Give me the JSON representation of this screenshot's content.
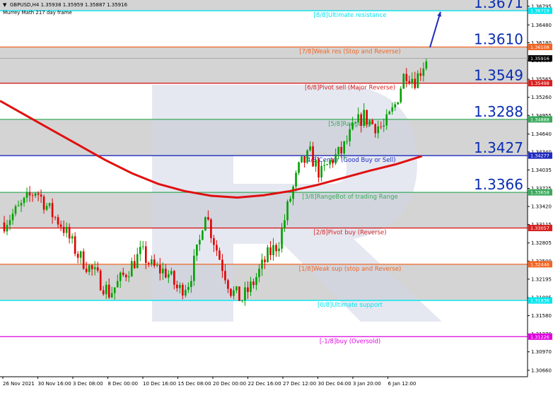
{
  "header": {
    "symbol_line": "GBPUSD,H4  1.35938 1.35959 1.35887 1.35916",
    "indicator_line": "Murrey Math 217 day frame"
  },
  "chart_data": {
    "type": "candlestick",
    "symbol": "GBPUSD",
    "timeframe": "H4",
    "ohlc": {
      "open": 1.35938,
      "high": 1.35959,
      "low": 1.35887,
      "close": 1.35916
    },
    "current_price": 1.35916,
    "ylim": [
      1.3055,
      1.369
    ],
    "x_ticks": [
      "26 Nov 2021",
      "30 Nov 16:00",
      "3 Dec 08:00",
      "8 Dec 00:00",
      "10 Dec 16:00",
      "15 Dec 08:00",
      "20 Dec 00:00",
      "22 Dec 16:00",
      "27 Dec 12:00",
      "30 Dec 04:00",
      "3 Jan 20:00",
      "6 Jan 12:00"
    ],
    "y_ticks": [
      "1.36795",
      "1.36480",
      "1.36180",
      "1.35880",
      "1.35565",
      "1.35260",
      "1.34955",
      "1.34640",
      "1.34340",
      "1.34035",
      "1.33725",
      "1.33420",
      "1.33115",
      "1.32805",
      "1.32500",
      "1.32195",
      "1.31885",
      "1.31580",
      "1.31270",
      "1.30970",
      "1.30660"
    ],
    "levels": [
      {
        "label": "[8/8]Ultimate resistance",
        "price": 1.36719,
        "tag": "1.36719",
        "big": "1.3671",
        "color": "#00e5ee"
      },
      {
        "label": "[7/8]Weak res (Stop and Reverse)",
        "price": 1.36108,
        "tag": "1.36108",
        "big": "1.3610",
        "color": "#f26522"
      },
      {
        "label": "[6/8]Pivot sell (Major Reverse)",
        "price": 1.35498,
        "tag": "1.35498",
        "big": "1.3549",
        "color": "#d81e1e"
      },
      {
        "label": "[5/8]RangeTop",
        "price": 1.34888,
        "tag": "1.34888",
        "big": "1.3288",
        "color": "#3aaa5c"
      },
      {
        "label": "[4/8]Center (Good Buy or Sell)",
        "price": 1.34277,
        "tag": "1.34277",
        "big": "1.3427",
        "color": "#1f2bbf"
      },
      {
        "label": "[3/8]RangeBot of trading Range",
        "price": 1.33658,
        "tag": "1.33658",
        "big": "1.3366",
        "color": "#3aaa5c"
      },
      {
        "label": "[2/8]Pivot buy (Reverse)",
        "price": 1.33057,
        "tag": "1.33057",
        "big": "",
        "color": "#d81e1e"
      },
      {
        "label": "[1/8]Weak sup (stop and Reverse)",
        "price": 1.32446,
        "tag": "1.32446",
        "big": "",
        "color": "#f26522"
      },
      {
        "label": "[0/8]Ultimate support",
        "price": 1.31836,
        "tag": "1.31836",
        "big": "",
        "color": "#00e5ee"
      },
      {
        "label": "[-1/8]buy (Oversold)",
        "price": 1.31226,
        "tag": "1.31226",
        "big": "",
        "color": "#e000e0"
      }
    ],
    "moving_average": {
      "color": "#e01010",
      "points": [
        [
          0,
          1.352
        ],
        [
          0.05,
          1.3495
        ],
        [
          0.1,
          1.347
        ],
        [
          0.15,
          1.3445
        ],
        [
          0.2,
          1.342
        ],
        [
          0.25,
          1.3398
        ],
        [
          0.3,
          1.338
        ],
        [
          0.35,
          1.3368
        ],
        [
          0.4,
          1.336
        ],
        [
          0.45,
          1.3357
        ],
        [
          0.5,
          1.3361
        ],
        [
          0.55,
          1.3368
        ],
        [
          0.6,
          1.3378
        ],
        [
          0.65,
          1.339
        ],
        [
          0.7,
          1.3402
        ],
        [
          0.75,
          1.3413
        ],
        [
          0.8,
          1.3427
        ]
      ]
    },
    "price_path": [
      [
        0,
        1.3315
      ],
      [
        0.03,
        1.334
      ],
      [
        0.06,
        1.337
      ],
      [
        0.09,
        1.333
      ],
      [
        0.11,
        1.331
      ],
      [
        0.14,
        1.326
      ],
      [
        0.17,
        1.323
      ],
      [
        0.2,
        1.3195
      ],
      [
        0.23,
        1.323
      ],
      [
        0.26,
        1.3265
      ],
      [
        0.28,
        1.324
      ],
      [
        0.31,
        1.323
      ],
      [
        0.33,
        1.32
      ],
      [
        0.35,
        1.3215
      ],
      [
        0.37,
        1.328
      ],
      [
        0.38,
        1.334
      ],
      [
        0.39,
        1.3305
      ],
      [
        0.41,
        1.325
      ],
      [
        0.43,
        1.32
      ],
      [
        0.45,
        1.3185
      ],
      [
        0.47,
        1.321
      ],
      [
        0.5,
        1.326
      ],
      [
        0.52,
        1.328
      ],
      [
        0.54,
        1.335
      ],
      [
        0.56,
        1.341
      ],
      [
        0.58,
        1.343
      ],
      [
        0.6,
        1.3395
      ],
      [
        0.62,
        1.342
      ],
      [
        0.64,
        1.3435
      ],
      [
        0.66,
        1.347
      ],
      [
        0.68,
        1.3495
      ],
      [
        0.7,
        1.348
      ],
      [
        0.72,
        1.3475
      ],
      [
        0.74,
        1.351
      ],
      [
        0.76,
        1.357
      ],
      [
        0.78,
        1.3555
      ],
      [
        0.8,
        1.3592
      ]
    ],
    "arrow": {
      "from": [
        0.815,
        1.361
      ],
      "to": [
        0.835,
        1.367
      ],
      "color": "#1f2bbf"
    },
    "current_price_tag_color": "#000000"
  }
}
